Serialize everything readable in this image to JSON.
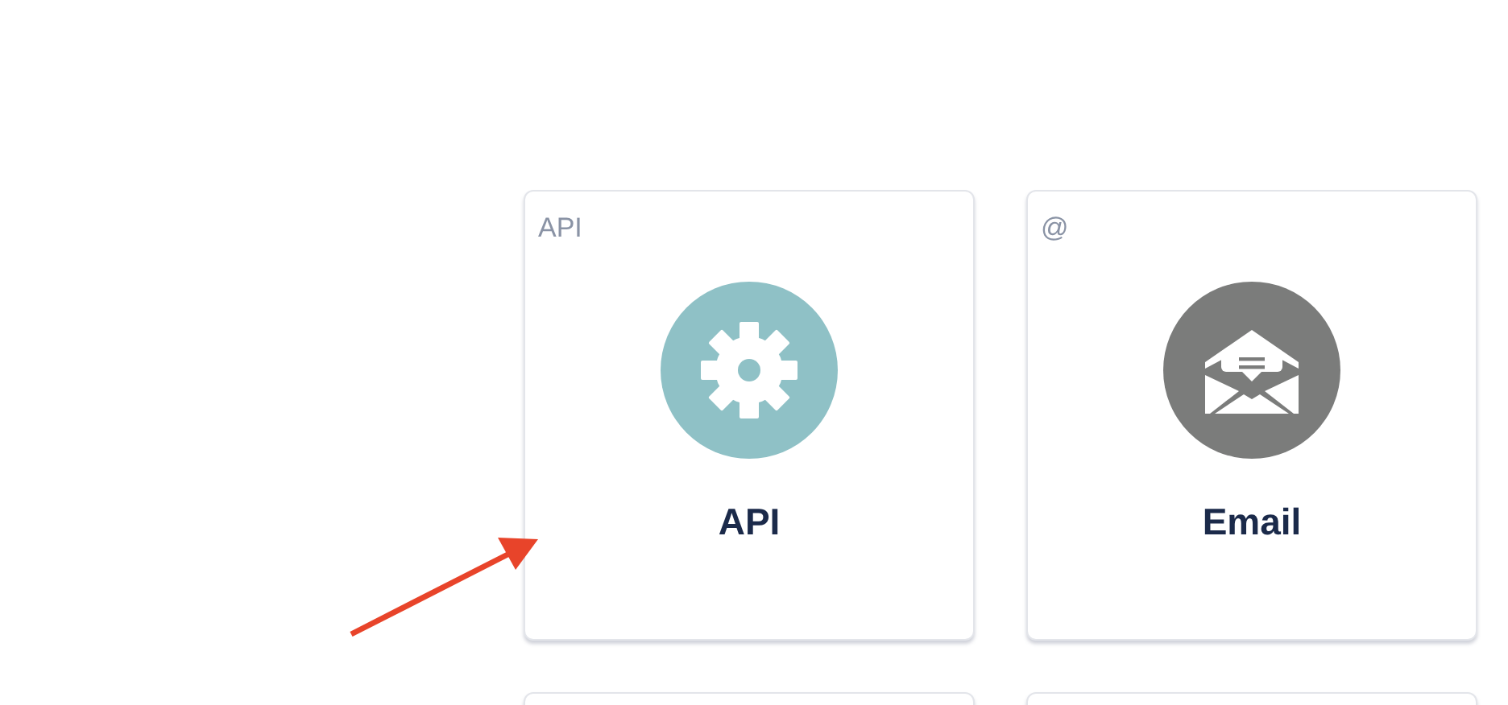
{
  "cards": [
    {
      "kind": "api",
      "badge": "API",
      "title": "API"
    },
    {
      "kind": "email",
      "badge": "@",
      "title": "Email"
    }
  ]
}
